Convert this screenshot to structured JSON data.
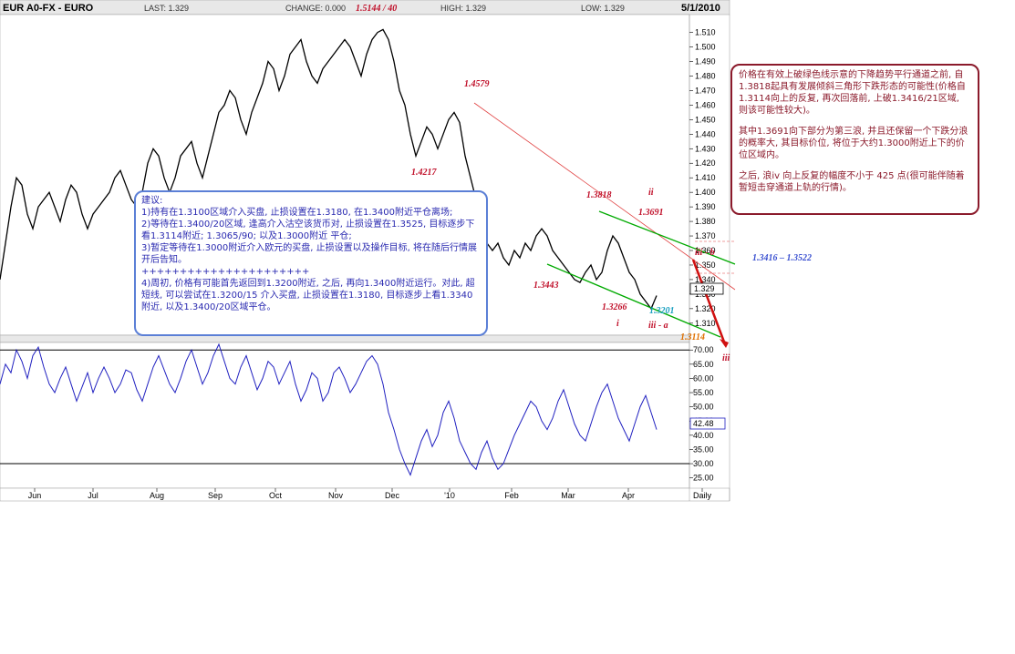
{
  "header": {
    "symbol": "EUR A0-FX - EURO",
    "last": "LAST: 1.329",
    "change": "CHANGE: 0.000",
    "high": "HIGH: 1.329",
    "low": "LOW: 1.329",
    "date": "5/1/2010",
    "peak_annotation": "1.5144 / 40"
  },
  "chart_data": {
    "type": "line",
    "title": "EUR A0-FX - EURO",
    "frequency": "Daily",
    "price_axis": {
      "range": [
        1.303,
        1.521
      ],
      "ticks": [
        "1.510",
        "1.500",
        "1.490",
        "1.480",
        "1.470",
        "1.460",
        "1.450",
        "1.440",
        "1.430",
        "1.420",
        "1.410",
        "1.400",
        "1.390",
        "1.380",
        "1.370",
        "1.360",
        "1.350",
        "1.340",
        "1.330",
        "1.320",
        "1.310"
      ],
      "last_price_label": "1.329"
    },
    "oscillator_axis": {
      "range": [
        22,
        72
      ],
      "ticks": [
        "70.00",
        "65.00",
        "60.00",
        "55.00",
        "50.00",
        "45.00",
        "40.00",
        "35.00",
        "30.00",
        "25.00"
      ],
      "last_value_label": "42.48",
      "reference_lines": [
        70,
        30
      ]
    },
    "x_labels": [
      "Jun",
      "Jul",
      "Aug",
      "Sep",
      "Oct",
      "Nov",
      "Dec",
      "'10",
      "Feb",
      "Mar",
      "Apr",
      "Daily"
    ],
    "price_series": {
      "name": "",
      "x": [
        0,
        6,
        12,
        18,
        24,
        30,
        36,
        42,
        48,
        54,
        60,
        66,
        72,
        78,
        84,
        90,
        96,
        102,
        108,
        114,
        120,
        126,
        132,
        138,
        144,
        150,
        156,
        162,
        168,
        174,
        180,
        186,
        192,
        198,
        204,
        210,
        216,
        222,
        228,
        234,
        240,
        246,
        252,
        258,
        264,
        270,
        276,
        282,
        288,
        294,
        300,
        306,
        312,
        318,
        324,
        330,
        336,
        342,
        348,
        354,
        360,
        366,
        372,
        378,
        384,
        390,
        396,
        402,
        408,
        414,
        420,
        426,
        432,
        438,
        444,
        450,
        456,
        462,
        468,
        474,
        480,
        486,
        492,
        498,
        504,
        510,
        516,
        522,
        528,
        534,
        540,
        546,
        552,
        558,
        564,
        570,
        576,
        582,
        588,
        594,
        600,
        606,
        612,
        618,
        624,
        630,
        636,
        642,
        648,
        654,
        660,
        666,
        672,
        678,
        684,
        690,
        696,
        702,
        708,
        714,
        720,
        726,
        732,
        738,
        744,
        750,
        756
      ],
      "y": [
        1.34,
        1.365,
        1.39,
        1.41,
        1.405,
        1.385,
        1.375,
        1.39,
        1.395,
        1.4,
        1.39,
        1.38,
        1.395,
        1.405,
        1.4,
        1.385,
        1.375,
        1.385,
        1.39,
        1.395,
        1.4,
        1.41,
        1.415,
        1.405,
        1.395,
        1.39,
        1.4,
        1.42,
        1.43,
        1.425,
        1.41,
        1.4,
        1.41,
        1.425,
        1.43,
        1.435,
        1.42,
        1.41,
        1.425,
        1.44,
        1.455,
        1.46,
        1.47,
        1.465,
        1.45,
        1.44,
        1.455,
        1.465,
        1.475,
        1.49,
        1.485,
        1.47,
        1.48,
        1.495,
        1.5,
        1.505,
        1.49,
        1.48,
        1.475,
        1.485,
        1.49,
        1.495,
        1.5,
        1.505,
        1.5,
        1.49,
        1.48,
        1.495,
        1.505,
        1.51,
        1.512,
        1.505,
        1.49,
        1.47,
        1.46,
        1.44,
        1.425,
        1.435,
        1.445,
        1.44,
        1.43,
        1.44,
        1.45,
        1.455,
        1.448,
        1.425,
        1.41,
        1.395,
        1.38,
        1.365,
        1.36,
        1.365,
        1.355,
        1.35,
        1.36,
        1.355,
        1.365,
        1.36,
        1.37,
        1.375,
        1.37,
        1.36,
        1.355,
        1.35,
        1.345,
        1.34,
        1.338,
        1.345,
        1.35,
        1.34,
        1.345,
        1.36,
        1.37,
        1.365,
        1.355,
        1.345,
        1.34,
        1.33,
        1.325,
        1.32,
        1.329
      ]
    },
    "oscillator_series": {
      "name": "",
      "x": [
        0,
        6,
        12,
        18,
        24,
        30,
        36,
        42,
        48,
        54,
        60,
        66,
        72,
        78,
        84,
        90,
        96,
        102,
        108,
        114,
        120,
        126,
        132,
        138,
        144,
        150,
        156,
        162,
        168,
        174,
        180,
        186,
        192,
        198,
        204,
        210,
        216,
        222,
        228,
        234,
        240,
        246,
        252,
        258,
        264,
        270,
        276,
        282,
        288,
        294,
        300,
        306,
        312,
        318,
        324,
        330,
        336,
        342,
        348,
        354,
        360,
        366,
        372,
        378,
        384,
        390,
        396,
        402,
        408,
        414,
        420,
        426,
        432,
        438,
        444,
        450,
        456,
        462,
        468,
        474,
        480,
        486,
        492,
        498,
        504,
        510,
        516,
        522,
        528,
        534,
        540,
        546,
        552,
        558,
        564,
        570,
        576,
        582,
        588,
        594,
        600,
        606,
        612,
        618,
        624,
        630,
        636,
        642,
        648,
        654,
        660,
        666,
        672,
        678,
        684,
        690,
        696,
        702,
        708,
        714,
        720,
        726,
        732,
        738,
        744,
        750,
        756
      ],
      "y": [
        58,
        65,
        62,
        70,
        66,
        60,
        68,
        71,
        64,
        58,
        55,
        60,
        64,
        58,
        52,
        57,
        62,
        55,
        60,
        64,
        60,
        55,
        58,
        63,
        62,
        56,
        52,
        58,
        64,
        68,
        63,
        58,
        55,
        60,
        66,
        70,
        64,
        58,
        62,
        68,
        72,
        66,
        60,
        58,
        64,
        68,
        62,
        56,
        60,
        66,
        64,
        58,
        62,
        66,
        58,
        52,
        56,
        62,
        60,
        52,
        55,
        62,
        64,
        60,
        55,
        58,
        62,
        66,
        68,
        65,
        58,
        48,
        42,
        35,
        30,
        26,
        32,
        38,
        42,
        36,
        40,
        48,
        52,
        46,
        38,
        34,
        30,
        28,
        34,
        38,
        32,
        28,
        30,
        35,
        40,
        44,
        48,
        52,
        50,
        45,
        42,
        46,
        52,
        56,
        50,
        44,
        40,
        38,
        44,
        50,
        55,
        58,
        52,
        46,
        42,
        38,
        44,
        50,
        54,
        48,
        42
      ]
    },
    "annotations": [
      "1.4579",
      "1.4217",
      "1.3818",
      "1.3691",
      "1.3443",
      "1.3266",
      "1.3201",
      "1.3114",
      "1.3416 – 1.3522",
      "ii",
      "i",
      "iii - a",
      "iii - b",
      "iii"
    ]
  },
  "advice": {
    "title": "建议:",
    "lines": [
      "1)持有在1.3100区域介入买盘, 止损设置在1.3180, 在1.3400附近平仓离场;",
      "2)等待在1.3400/20区域, 逢高介入沽空该货币对, 止损设置在1.3525, 目标逐步下看1.3114附近; 1.3065/90; 以及1.3000附近 平仓;",
      "3)暂定等待在1.3000附近介入欧元的买盘, 止损设置以及操作目标, 将在随后行情展开后告知。",
      "++++++++++++++++++++++",
      "4)周初, 价格有可能首先返回到1.3200附近, 之后, 再向1.3400附近运行。对此, 超短线, 可以尝试在1.3200/15 介入买盘, 止损设置在1.3180, 目标逐步上看1.3340附近, 以及1.3400/20区域平仓。"
    ]
  },
  "analysis": {
    "p1": "价格在有效上破绿色线示意的下降趋势平行通道之前, 自1.3818起具有发展倾斜三角形下跌形态的可能性(价格自1.3114向上的反复, 再次回落前, 上破1.3416/21区域, 则该可能性较大)。",
    "p2": "其中1.3691向下部分为第三浪, 并且还保留一个下跌分浪的概率大, 其目标价位, 将位于大约1.3000附近上下的价位区域内。",
    "p3": "之后, 浪iv 向上反复的幅度不小于 425 点(很可能伴随着暂短击穿通道上轨的行情)。"
  },
  "colors": {
    "price": "#000000",
    "oscillator": "#2020c0",
    "channel": "#00aa00",
    "trendline": "#e04040",
    "wave_label": "#8b1a2b",
    "advice_border": "#5b7fd6"
  }
}
